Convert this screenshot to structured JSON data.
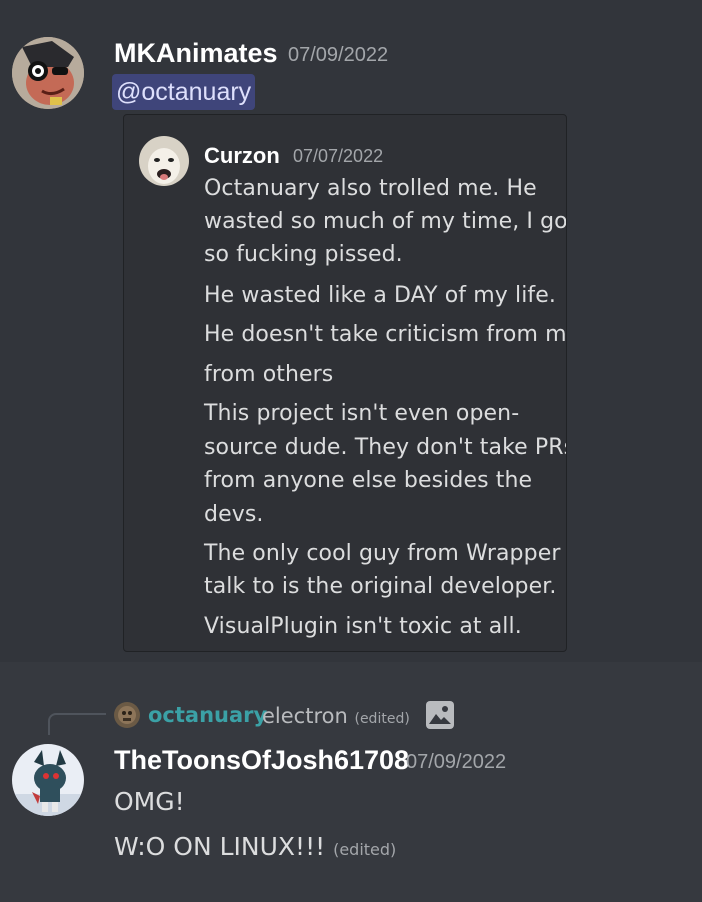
{
  "message1": {
    "username": "MKAnimates",
    "timestamp": "07/09/2022",
    "mention": "@octanuary",
    "embed": {
      "author": "Curzon",
      "timestamp": "07/07/2022",
      "lines": [
        "Octanuary also trolled me. He",
        "wasted so much of my time, I got",
        "so fucking pissed.",
        "He wasted like a DAY of my life.",
        "He doesn't take criticism from me",
        "from others",
        "This project isn't even open-",
        "source dude. They don't take PRs",
        "from anyone else besides the",
        "devs.",
        "The only cool guy from Wrapper I",
        "talk to is the original developer.",
        "VisualPlugin isn't toxic at all."
      ]
    }
  },
  "message2": {
    "reply": {
      "username": "octanuary",
      "text": "electron",
      "edited": "(edited)",
      "attachment_icon": "image-icon"
    },
    "username": "TheToonsOfJosh61708",
    "timestamp": "07/09/2022",
    "lines": [
      "OMG!",
      "W:O ON LINUX!!!"
    ],
    "edited": "(edited)"
  },
  "colors": {
    "background": "#36393f",
    "hover_background": "#32353b",
    "embed_background": "#2f3136",
    "mention_text": "#dee0fc",
    "reply_username": "#3ba1a6"
  }
}
